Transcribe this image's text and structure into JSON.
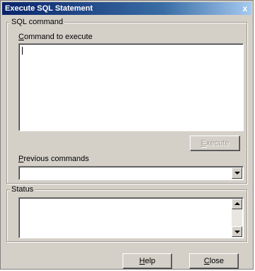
{
  "window": {
    "title": "Execute SQL Statement",
    "close_glyph": "x"
  },
  "sql_group": {
    "legend": "SQL command",
    "command_label_mnemonic": "C",
    "command_label_rest": "ommand to execute",
    "command_value": "",
    "execute_mnemonic": "E",
    "execute_rest": "xecute",
    "previous_label_mnemonic": "P",
    "previous_label_rest": "revious commands",
    "previous_value": ""
  },
  "status_group": {
    "legend": "Status",
    "status_value": ""
  },
  "footer": {
    "help_mnemonic": "H",
    "help_rest": "elp",
    "close_mnemonic": "C",
    "close_rest": "lose"
  },
  "icons": {
    "dropdown": "chevron-down-icon",
    "scroll_up": "scroll-up-arrow-icon",
    "scroll_down": "scroll-down-arrow-icon"
  }
}
